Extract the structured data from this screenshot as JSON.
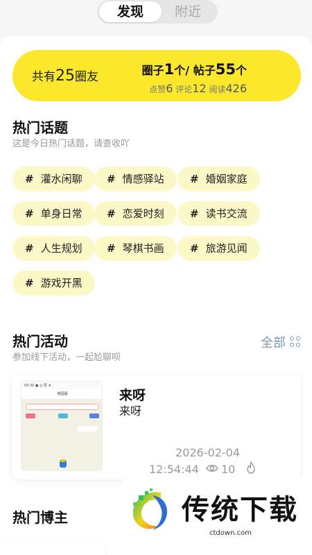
{
  "top_tabs": {
    "active": "发现",
    "inactive": "附近"
  },
  "stats": {
    "total_prefix": "共有",
    "total_count": "25",
    "total_suffix": "圈友",
    "circles_label": "圈子",
    "circles_count": "1",
    "circles_unit": "个/",
    "posts_label": "帖子",
    "posts_count": "55",
    "posts_unit": "个",
    "likes_label": "点赞",
    "likes_count": "6",
    "comments_label": "评论",
    "comments_count": "12",
    "reads_label": "阅读",
    "reads_count": "426"
  },
  "hot_topics": {
    "title": "热门话题",
    "subtitle": "这是今日热门话题，请查收吖",
    "hash": "#",
    "items": [
      "灌水闲聊",
      "情感驿站",
      "婚姻家庭",
      "单身日常",
      "恋爱时刻",
      "读书交流",
      "人生规划",
      "琴棋书画",
      "旅游见闻",
      "游戏开黑"
    ]
  },
  "hot_activities": {
    "title": "热门活动",
    "subtitle": "参加线下活动，一起尬聊呗",
    "all_label": "全部",
    "card": {
      "title": "来呀",
      "desc": "来呀",
      "date": "2026-02-04",
      "time": "12:54:44",
      "views": "10",
      "thumb_status": "09:36 ● ◎ 赞 ★",
      "thumb_header": "我园福"
    }
  },
  "hot_bloggers": {
    "title": "热门博主"
  },
  "watermark": {
    "brand": "传统下载",
    "url": "ctdown.com"
  },
  "colors": {
    "accent_yellow": "#fbe72c",
    "chip_bg": "#fdf8c8",
    "muted": "#999999",
    "link": "#7a9aac"
  }
}
